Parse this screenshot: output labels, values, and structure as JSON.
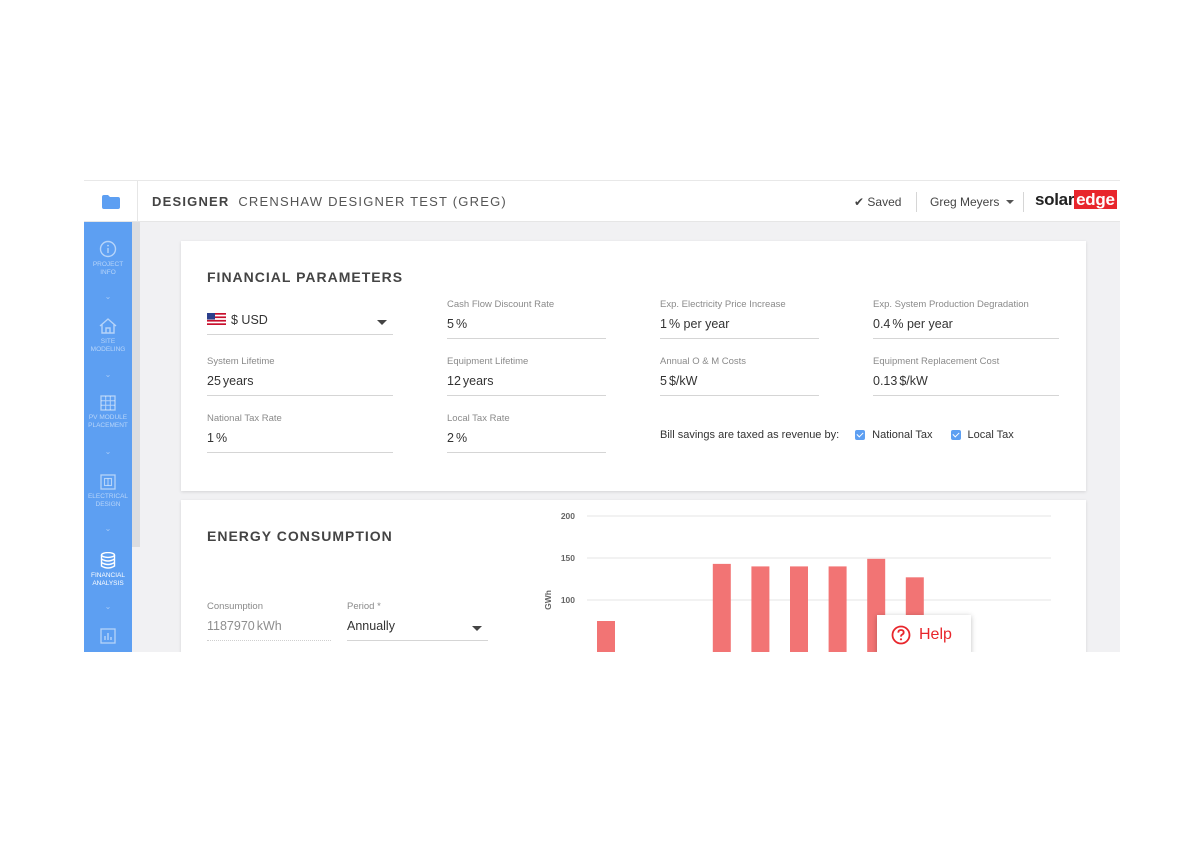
{
  "header": {
    "app_name": "DESIGNER",
    "project_title": "CRENSHAW DESIGNER TEST (GREG)",
    "saved_label": "Saved",
    "user_name": "Greg Meyers",
    "logo_text_1": "solar",
    "logo_text_2": "edge",
    "brand_color": "#e8262c"
  },
  "sidebar": {
    "color": "#5d9ff2",
    "items": [
      {
        "label_1": "PROJECT",
        "label_2": "INFO",
        "icon": "info-icon"
      },
      {
        "label_1": "SITE",
        "label_2": "MODELING",
        "icon": "home-icon"
      },
      {
        "label_1": "PV MODULE",
        "label_2": "PLACEMENT",
        "icon": "grid-icon"
      },
      {
        "label_1": "ELECTRICAL",
        "label_2": "DESIGN",
        "icon": "electrical-icon"
      },
      {
        "label_1": "FINANCIAL",
        "label_2": "ANALYSIS",
        "icon": "database-icon",
        "active": true
      },
      {
        "label_1": "",
        "label_2": "",
        "icon": "report-icon"
      }
    ]
  },
  "financial": {
    "title": "FINANCIAL PARAMETERS",
    "currency": "$ USD",
    "cash_flow_label": "Cash Flow Discount Rate",
    "cash_flow_value": "5",
    "cash_flow_unit": "%",
    "elec_price_label": "Exp. Electricity Price Increase",
    "elec_price_value": "1",
    "elec_price_unit": "% per year",
    "degradation_label": "Exp. System Production Degradation",
    "degradation_value": "0.4",
    "degradation_unit": "% per year",
    "system_lifetime_label": "System Lifetime",
    "system_lifetime_value": "25",
    "system_lifetime_unit": "years",
    "equipment_lifetime_label": "Equipment Lifetime",
    "equipment_lifetime_value": "12",
    "equipment_lifetime_unit": "years",
    "om_label": "Annual O & M Costs",
    "om_value": "5",
    "om_unit": "$/kW",
    "replacement_label": "Equipment Replacement Cost",
    "replacement_value": "0.13",
    "replacement_unit": "$/kW",
    "national_tax_label": "National Tax Rate",
    "national_tax_value": "1",
    "national_tax_unit": "%",
    "local_tax_label": "Local Tax Rate",
    "local_tax_value": "2",
    "local_tax_unit": "%",
    "bill_savings_label": "Bill savings are taxed as revenue by:",
    "national_tax_checkbox": "National Tax",
    "local_tax_checkbox": "Local Tax"
  },
  "energy": {
    "title": "ENERGY CONSUMPTION",
    "consumption_label": "Consumption",
    "consumption_value": "1187970",
    "consumption_unit": "kWh",
    "period_label": "Period *",
    "period_value": "Annually"
  },
  "chart_data": {
    "type": "bar",
    "ylabel": "GWh",
    "ylim": [
      100,
      200
    ],
    "yticks": [
      200,
      150,
      100
    ],
    "values": [
      75,
      null,
      null,
      143,
      140,
      140,
      140,
      149,
      127
    ],
    "bar_color": "#f27474",
    "grid": true
  },
  "help": {
    "label": "Help"
  }
}
